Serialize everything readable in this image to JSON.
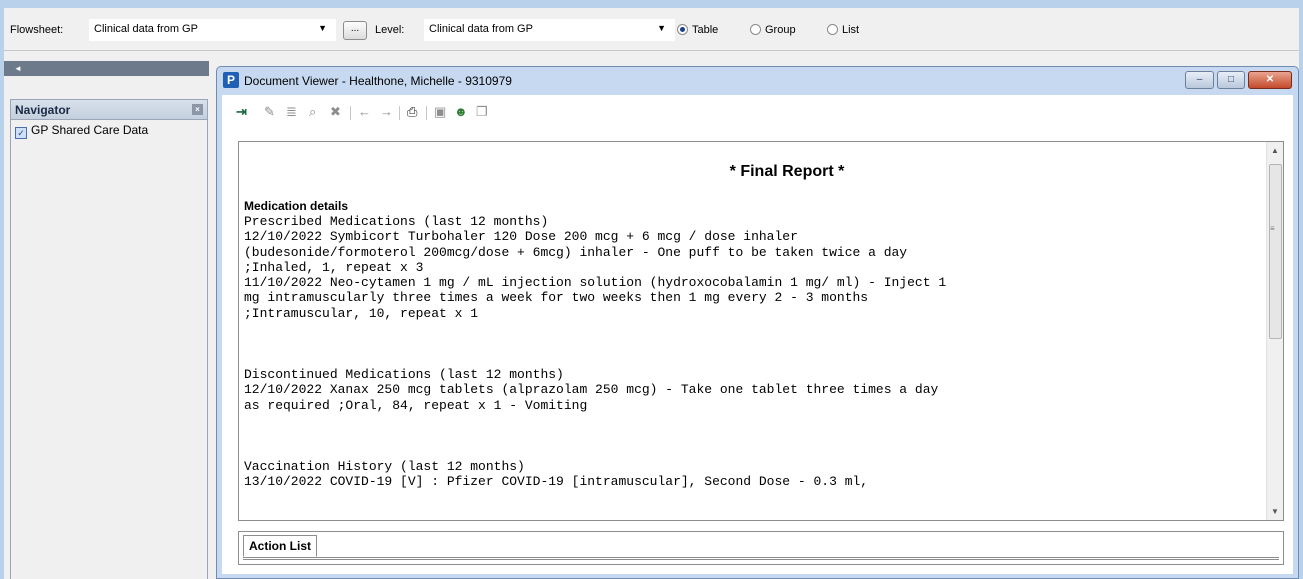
{
  "toolbar": {
    "flowsheet_label": "Flowsheet:",
    "flowsheet_value": "Clinical data from GP",
    "ellipsis_label": "...",
    "level_label": "Level:",
    "level_value": "Clinical data from GP",
    "views": [
      {
        "label": "Table",
        "selected": true
      },
      {
        "label": "Group",
        "selected": false
      },
      {
        "label": "List",
        "selected": false
      }
    ]
  },
  "navigator": {
    "title": "Navigator",
    "close_glyph": "×",
    "items": [
      {
        "label": "GP Shared Care Data",
        "checked": true
      }
    ]
  },
  "collapse_glyph": "◄",
  "viewer": {
    "app_icon_letter": "P",
    "title": "Document Viewer - Healthone, Michelle - 9310979",
    "controls": {
      "minimize": "–",
      "maximize": "□",
      "close": "✕"
    },
    "report": {
      "title": "* Final Report *",
      "section_heading": "Medication details",
      "block1": "Prescribed Medications (last 12 months)\n12/10/2022 Symbicort Turbohaler 120 Dose 200 mcg + 6 mcg / dose inhaler\n(budesonide/formoterol 200mcg/dose + 6mcg) inhaler - One puff to be taken twice a day\n;Inhaled, 1, repeat x 3\n11/10/2022 Neo-cytamen 1 mg / mL injection solution (hydroxocobalamin 1 mg/ ml) - Inject 1\nmg intramuscularly three times a week for two weeks then 1 mg every 2 - 3 months\n;Intramuscular, 10, repeat x 1",
      "block2": "Discontinued Medications (last 12 months)\n12/10/2022 Xanax 250 mcg tablets (alprazolam 250 mcg) - Take one tablet three times a day\nas required ;Oral, 84, repeat x 1 - Vomiting",
      "block3": "Vaccination History (last 12 months)\n13/10/2022 COVID-19 [V] : Pfizer COVID-19 [intramuscular], Second Dose - 0.3 ml,"
    },
    "action_tab_label": "Action List"
  }
}
